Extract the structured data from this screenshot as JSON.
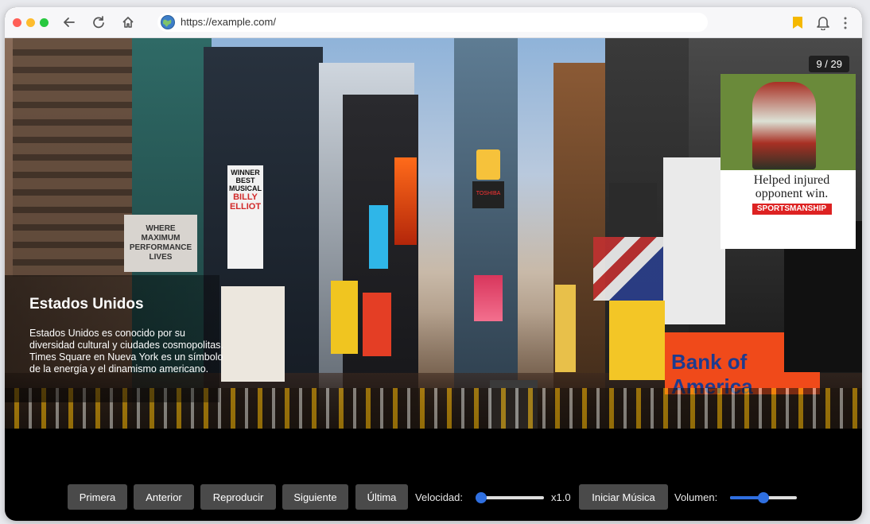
{
  "browser": {
    "url": "https://example.com/",
    "dots": [
      "#ff5f57",
      "#febc2e",
      "#28c840"
    ]
  },
  "slideshow": {
    "counter": "9 / 29",
    "caption_title": "Estados Unidos",
    "caption_text": "Estados Unidos es conocido por su diversidad cultural y ciudades cosmopolitas. Times Square en Nueva York es un símbolo de la energía y el dinamismo americano.",
    "photo_signs": {
      "winner": "WINNER BEST MUSICAL",
      "billy": "BILLY ELLIOT",
      "maximum": "WHERE MAXIMUM PERFORMANCE LIVES",
      "helped": "Helped injured opponent win.",
      "sportsmanship": "SPORTSMANSHIP",
      "bank": "Bank of America",
      "toshiba": "TOSHIBA"
    }
  },
  "controls": {
    "first": "Primera",
    "prev": "Anterior",
    "play": "Reproducir",
    "next": "Siguiente",
    "last": "Última",
    "speed_label": "Velocidad:",
    "speed_value": "x1.0",
    "speed_level": 0.08,
    "music": "Iniciar Música",
    "volume_label": "Volumen:",
    "volume_level": 0.5
  },
  "colors": {
    "accent": "#2f6fe0",
    "button_bg": "#4a4a4a",
    "bookmark": "#f5b800"
  }
}
